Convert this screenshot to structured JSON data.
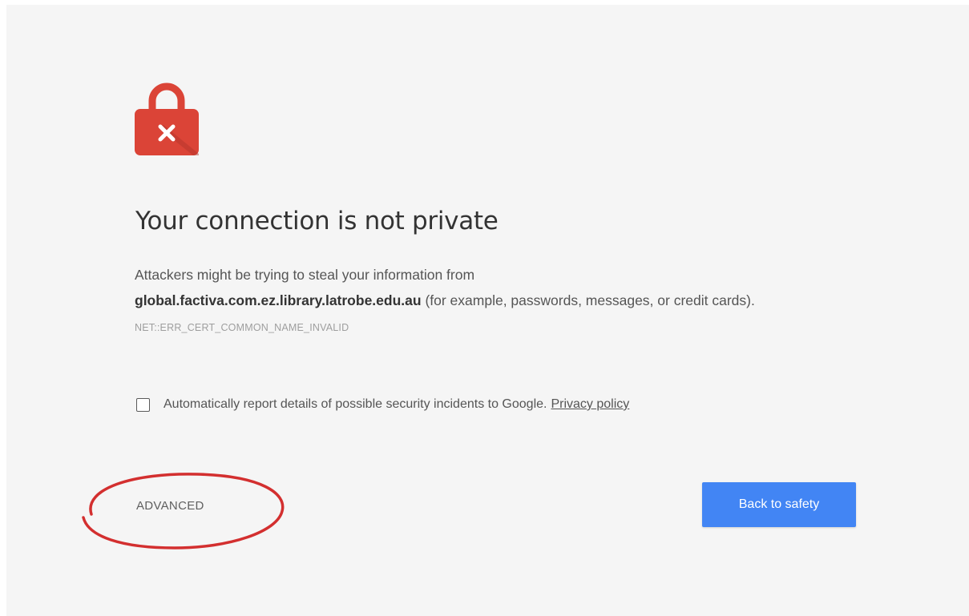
{
  "page": {
    "title": "Your connection is not private",
    "description_prefix": "Attackers might be trying to steal your information from",
    "host": "global.factiva.com.ez.library.latrobe.edu.au",
    "description_suffix": "(for example, passwords, messages, or credit cards).",
    "error_code": "NET::ERR_CERT_COMMON_NAME_INVALID"
  },
  "report": {
    "checked": false,
    "label": "Automatically report details of possible security incidents to Google.",
    "privacy_link": "Privacy policy"
  },
  "actions": {
    "advanced_label": "ADVANCED",
    "back_label": "Back to safety"
  },
  "icons": {
    "lock": "broken-lock-icon",
    "checkbox": "checkbox-icon"
  },
  "colors": {
    "background": "#f5f5f5",
    "lock": "#db4437",
    "primary_button": "#4285f4",
    "annotation": "#d32f2f"
  }
}
